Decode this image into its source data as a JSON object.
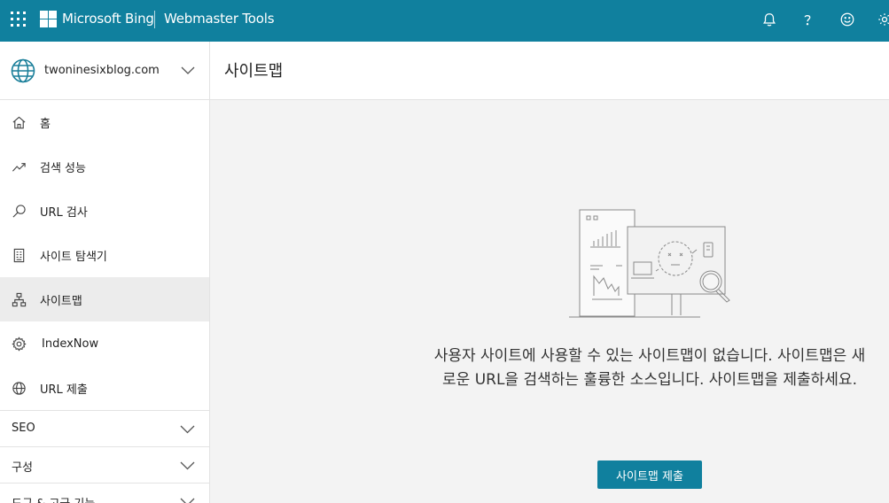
{
  "topbar": {
    "brand": "Microsoft Bing",
    "product": "Webmaster Tools"
  },
  "site": {
    "name": "twoninesixblog.com"
  },
  "sidebar": {
    "items": [
      {
        "label": "홈",
        "icon": "home-icon"
      },
      {
        "label": "검색 성능",
        "icon": "trend-icon"
      },
      {
        "label": "URL 검사",
        "icon": "search-icon"
      },
      {
        "label": "사이트 탐색기",
        "icon": "document-icon"
      },
      {
        "label": "사이트맵",
        "icon": "sitemap-icon",
        "active": true
      },
      {
        "label": "IndexNow",
        "icon": "gear-icon"
      },
      {
        "label": "URL 제출",
        "icon": "globe-icon"
      }
    ],
    "sections": [
      {
        "label": "SEO"
      },
      {
        "label": "구성"
      },
      {
        "label": "도구 & 고급 기능"
      }
    ]
  },
  "main": {
    "title": "사이트맵",
    "empty_message": "사용자 사이트에 사용할 수 있는 사이트맵이 없습니다. 사이트맵은 새로운 URL을 검색하는 훌륭한 소스입니다. 사이트맵을 제출하세요.",
    "submit_label": "사이트맵 제출"
  },
  "colors": {
    "accent": "#10809e",
    "sidebar_active": "#ececec",
    "background": "#f3f3f3"
  }
}
